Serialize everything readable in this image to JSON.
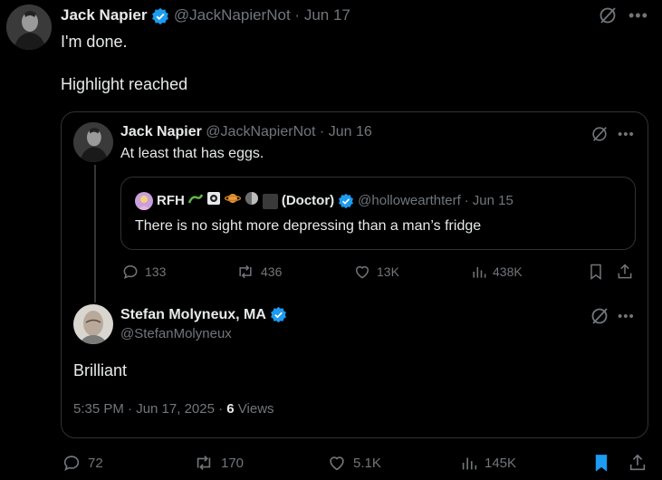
{
  "outer": {
    "name": "Jack Napier",
    "handle": "@JackNapierNot",
    "separator": "·",
    "date": "Jun 17",
    "text_line1": "I'm done.",
    "text_line2": "Highlight reached"
  },
  "inner": {
    "name": "Jack Napier",
    "handle": "@JackNapierNot",
    "separator": "·",
    "date": "Jun 16",
    "text": "At least that has eggs.",
    "nested": {
      "name_prefix": "RFH",
      "name_suffix": "(Doctor)",
      "handle": "@hollowearthterf",
      "separator": "·",
      "date": "Jun 15",
      "text": "There is no sight more depressing than a man’s fridge"
    },
    "actions": {
      "replies": "133",
      "reposts": "436",
      "likes": "13K",
      "views": "438K"
    }
  },
  "reply": {
    "name": "Stefan Molyneux, MA",
    "handle": "@StefanMolyneux",
    "text": "Brilliant",
    "time_date": "5:35 PM · Jun 17, 2025 ·",
    "views_count": "6",
    "views_label": "Views"
  },
  "bottom_actions": {
    "replies": "72",
    "reposts": "170",
    "likes": "5.1K",
    "views": "145K"
  },
  "colors": {
    "accent": "#1d9bf0",
    "muted": "#71767b",
    "border": "#2f3336"
  }
}
